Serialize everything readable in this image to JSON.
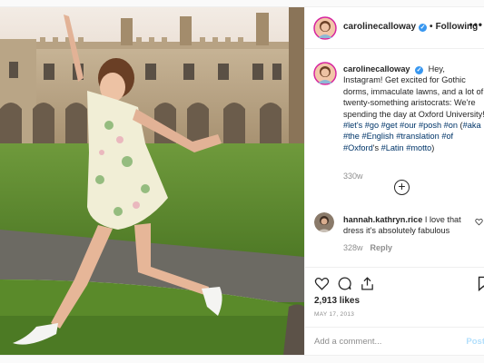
{
  "post": {
    "username": "carolinecalloway",
    "verified_mark": "✓",
    "dot": "•",
    "follow_state": "Following",
    "more_label": "•••",
    "caption_segments": [
      {
        "text": "Hey, Instagram! Get excited for Gothic dorms, immaculate lawns, and a lot of twenty-something aristocrats: We're spending the day at Oxford University! ",
        "tag": false
      },
      {
        "text": "#let's",
        "tag": true
      },
      {
        "text": " ",
        "tag": false
      },
      {
        "text": "#go",
        "tag": true
      },
      {
        "text": " ",
        "tag": false
      },
      {
        "text": "#get",
        "tag": true
      },
      {
        "text": " ",
        "tag": false
      },
      {
        "text": "#our",
        "tag": true
      },
      {
        "text": " ",
        "tag": false
      },
      {
        "text": "#posh",
        "tag": true
      },
      {
        "text": " ",
        "tag": false
      },
      {
        "text": "#on",
        "tag": true
      },
      {
        "text": " (",
        "tag": false
      },
      {
        "text": "#aka",
        "tag": true
      },
      {
        "text": " ",
        "tag": false
      },
      {
        "text": "#the",
        "tag": true
      },
      {
        "text": " ",
        "tag": false
      },
      {
        "text": "#English",
        "tag": true
      },
      {
        "text": " ",
        "tag": false
      },
      {
        "text": "#translation",
        "tag": true
      },
      {
        "text": " ",
        "tag": false
      },
      {
        "text": "#of",
        "tag": true
      },
      {
        "text": " ",
        "tag": false
      },
      {
        "text": "#Oxford",
        "tag": true
      },
      {
        "text": "'s ",
        "tag": false
      },
      {
        "text": "#Latin",
        "tag": true
      },
      {
        "text": " ",
        "tag": false
      },
      {
        "text": "#motto",
        "tag": true
      },
      {
        "text": ")",
        "tag": false
      }
    ],
    "caption_time": "330w",
    "load_more_icon": "+",
    "comment": {
      "username": "hannah.kathryn.rice",
      "text": "I love that dress it's absolutely fabulous",
      "time": "328w",
      "reply_label": "Reply"
    },
    "likes": "2,913 likes",
    "date": "MAY 17, 2013",
    "add_comment_placeholder": "Add a comment...",
    "post_button": "Post"
  },
  "colors": {
    "accent": "#3897f0",
    "hashtag": "#003569",
    "muted": "#8e8e8e",
    "post_disabled": "#b2dffc"
  },
  "icons": {
    "header_avatar": "avatar-icon",
    "verified": "verified-badge-icon",
    "heart": "heart-icon",
    "comment": "comment-icon",
    "share": "share-icon",
    "save": "bookmark-icon",
    "more": "more-options-icon",
    "load_more": "plus-circle-icon"
  }
}
